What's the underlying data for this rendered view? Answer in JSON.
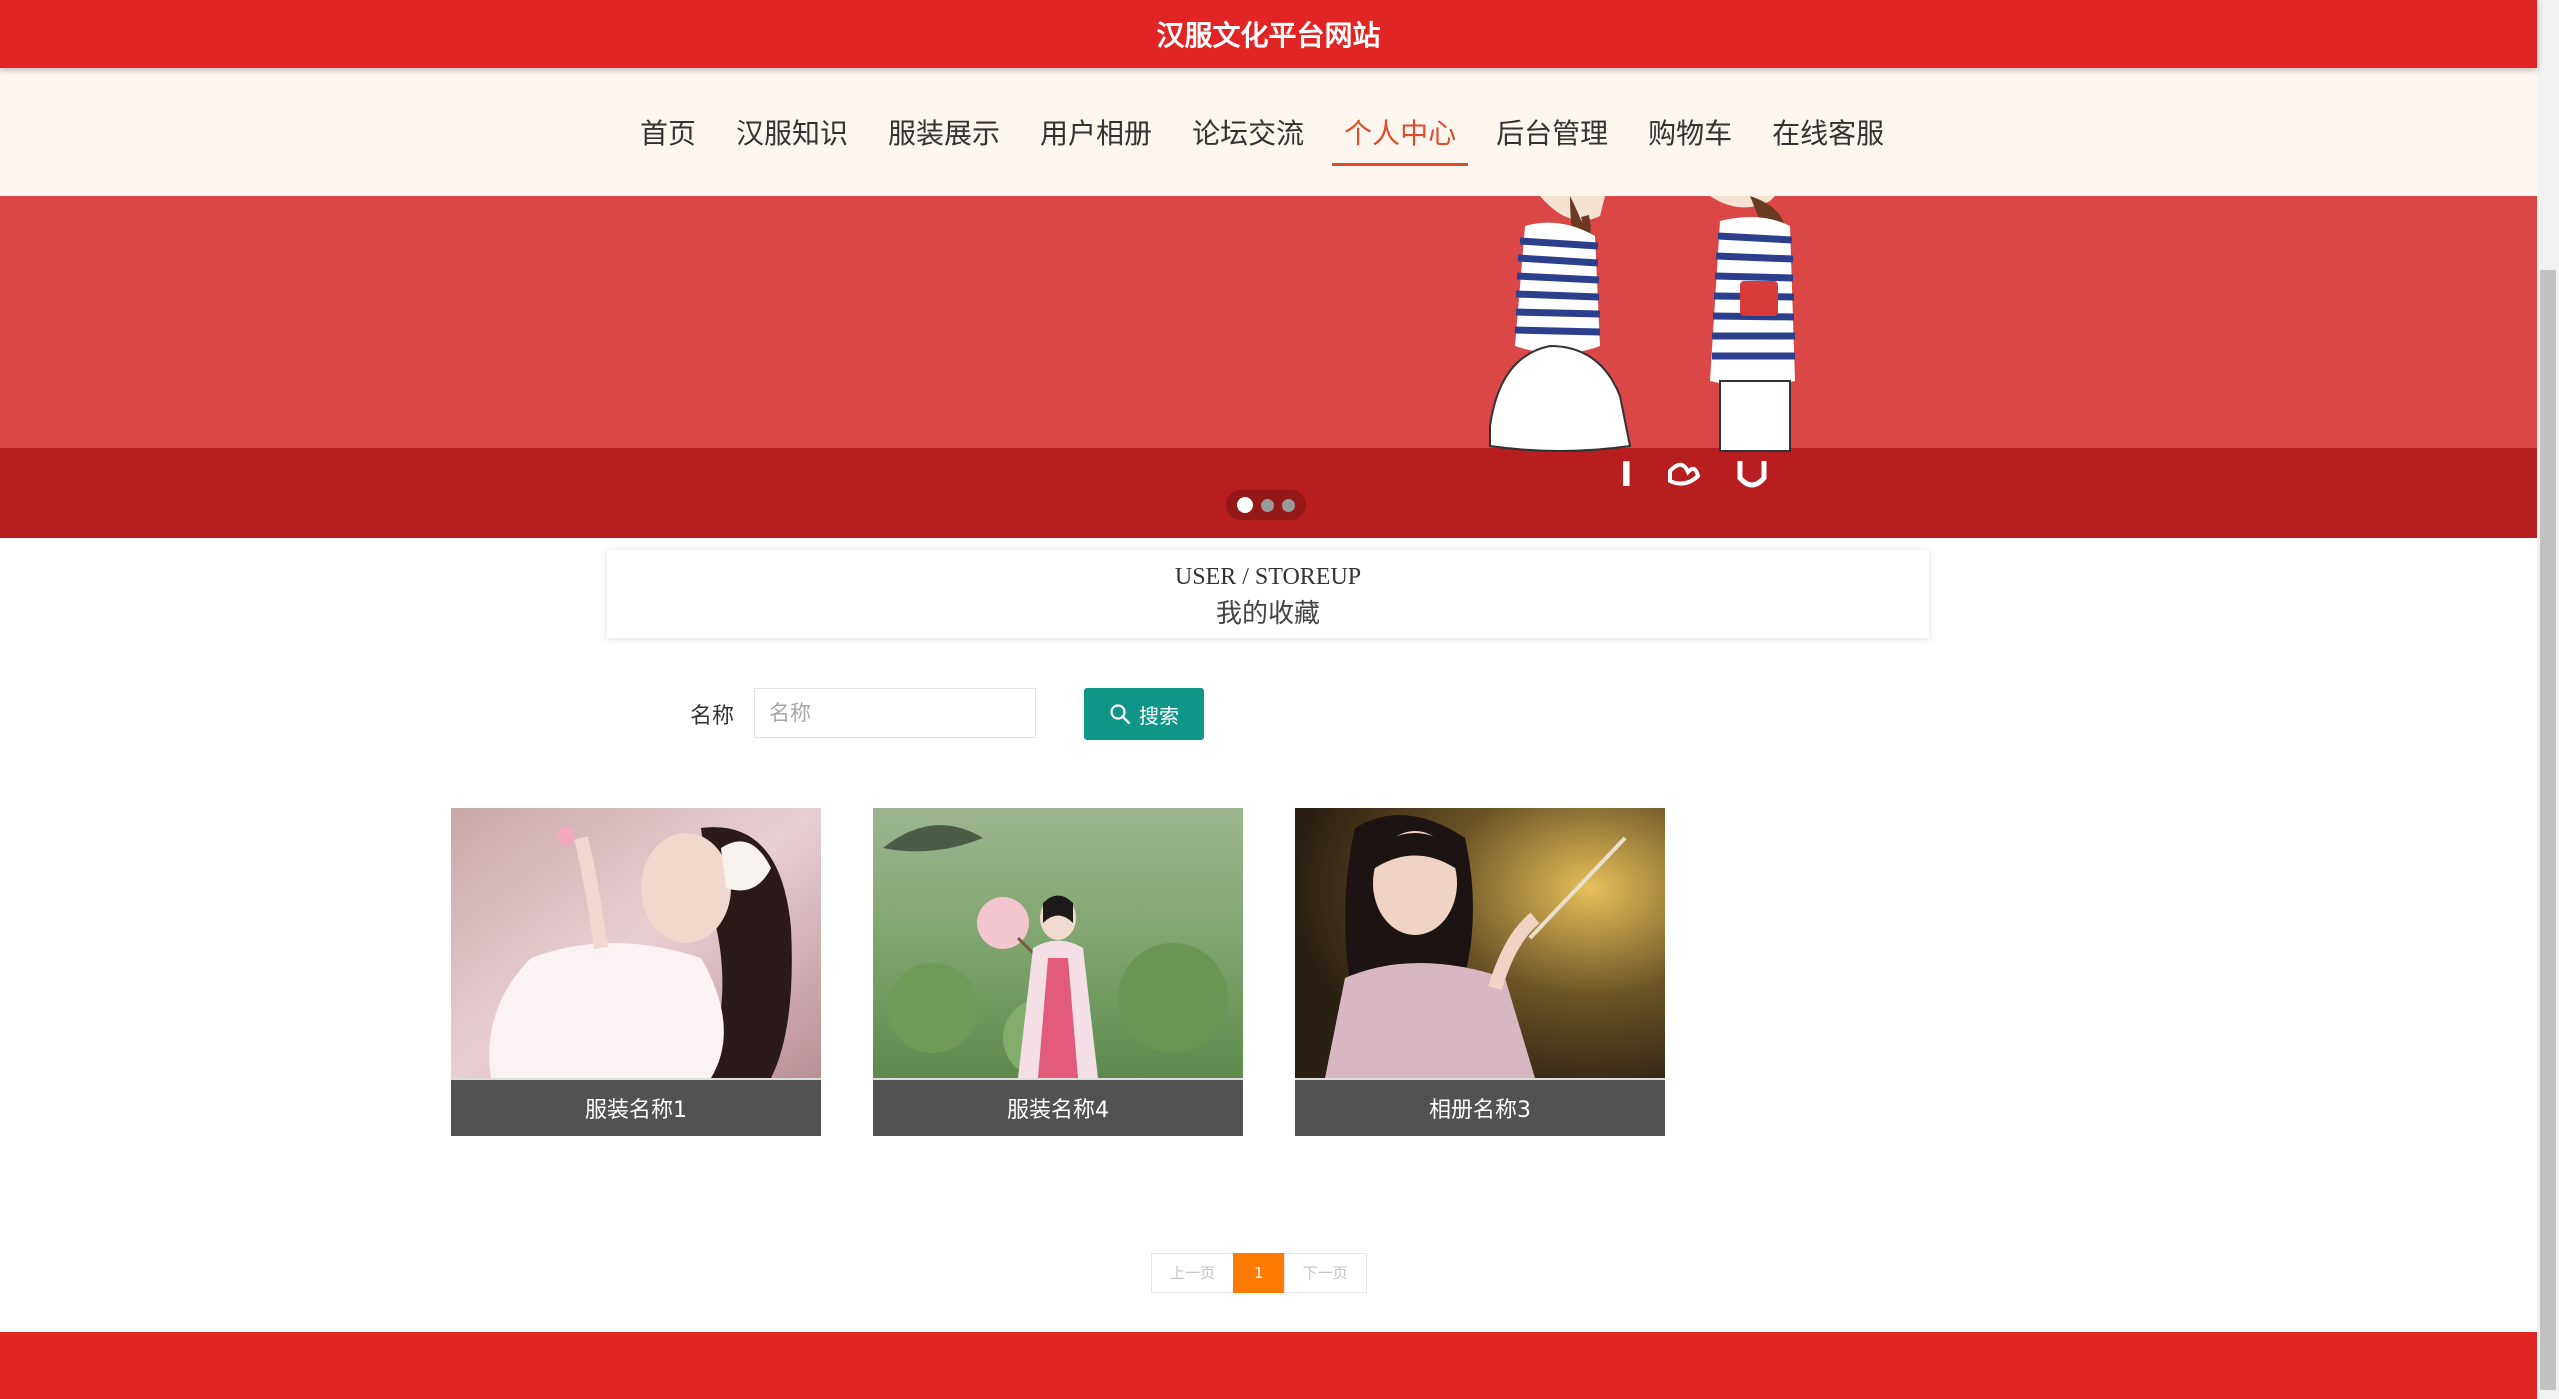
{
  "site_title": "汉服文化平台网站",
  "nav": [
    {
      "label": "首页"
    },
    {
      "label": "汉服知识"
    },
    {
      "label": "服装展示"
    },
    {
      "label": "用户相册"
    },
    {
      "label": "论坛交流"
    },
    {
      "label": "个人中心",
      "active": true
    },
    {
      "label": "后台管理"
    },
    {
      "label": "购物车"
    },
    {
      "label": "在线客服"
    }
  ],
  "banner": {
    "slide_count": 3,
    "active_slide": 1
  },
  "section": {
    "title_en": "USER / STOREUP",
    "title_cn": "我的收藏"
  },
  "search": {
    "label": "名称",
    "placeholder": "名称",
    "value": "",
    "button_label": "搜索"
  },
  "items": [
    {
      "caption": "服装名称1"
    },
    {
      "caption": "服装名称4"
    },
    {
      "caption": "相册名称3"
    }
  ],
  "pagination": {
    "prev_label": "上一页",
    "current": "1",
    "next_label": "下一页"
  },
  "colors": {
    "primary_red": "#e12424",
    "teal": "#0f9688",
    "orange": "#ff7a00",
    "nav_active": "#e04b2c"
  }
}
